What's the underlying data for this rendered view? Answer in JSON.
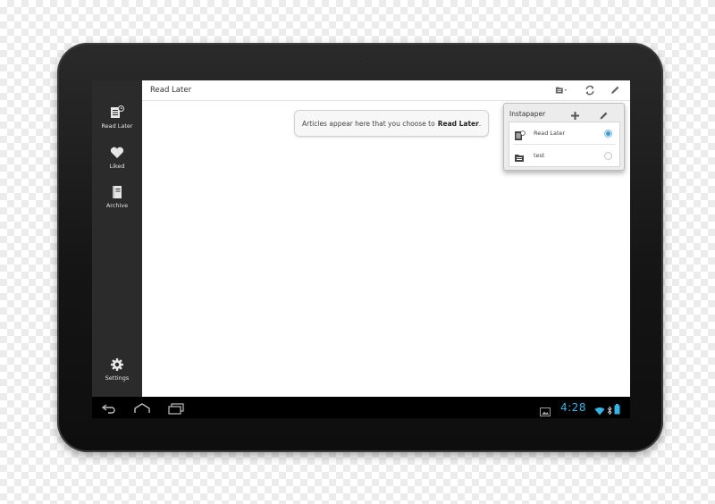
{
  "app": {
    "page_title": "Read Later",
    "accent_color": "#33b5e5"
  },
  "sidebar": {
    "items": [
      {
        "label": "Read Later",
        "icon": "read-later-icon"
      },
      {
        "label": "Liked",
        "icon": "heart-icon"
      },
      {
        "label": "Archive",
        "icon": "archive-icon"
      }
    ],
    "settings_label": "Settings"
  },
  "actionbar": {
    "icons": [
      "folder-dropdown-icon",
      "sync-icon",
      "edit-icon"
    ]
  },
  "empty_state": {
    "text": "Articles appear here that you choose to",
    "emphasis": "Read Later",
    "suffix": "."
  },
  "folder_popup": {
    "title": "Instapaper",
    "icons": [
      "plus-icon",
      "pencil-icon"
    ],
    "folders": [
      {
        "name": "Read Later",
        "selected": true
      },
      {
        "name": "test",
        "selected": false
      }
    ]
  },
  "system_bar": {
    "time": "4:28",
    "icons": [
      "back-icon",
      "home-icon",
      "recent-apps-icon",
      "gallery-icon",
      "wifi-icon",
      "bluetooth-icon",
      "battery-icon"
    ]
  }
}
